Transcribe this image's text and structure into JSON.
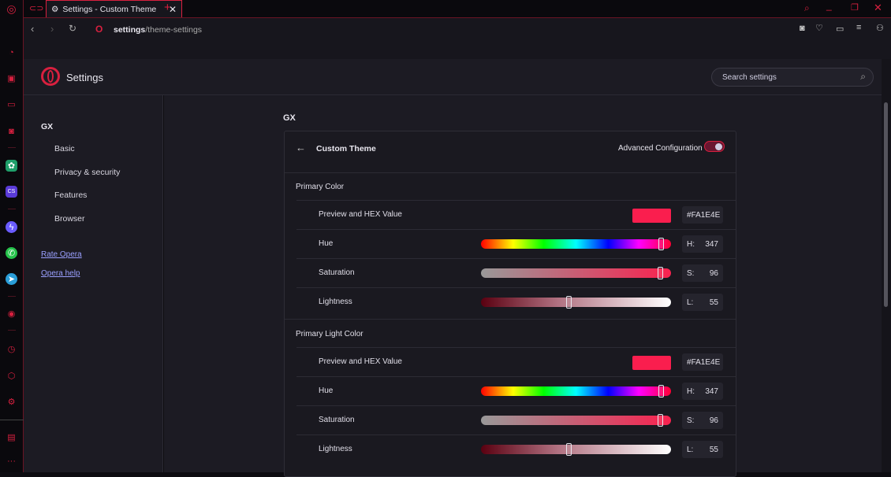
{
  "browser": {
    "tab_title": "Settings - Custom Theme",
    "url_bold": "settings",
    "url_rest": "/theme-settings"
  },
  "settings": {
    "title": "Settings",
    "search_placeholder": "Search settings"
  },
  "nav": {
    "group": "GX",
    "items": [
      "Basic",
      "Privacy & security",
      "Features",
      "Browser"
    ],
    "links": [
      "Rate Opera",
      "Opera help"
    ]
  },
  "page": {
    "section": "GX",
    "card_title": "Custom Theme",
    "advanced_label": "Advanced Configuration",
    "advanced_on": true
  },
  "sections": [
    {
      "title": "Primary Color",
      "preview_label": "Preview and HEX Value",
      "hex": "FA1E4E",
      "swatch": "#fa1e4e",
      "hue_label": "Hue",
      "hue_prefix": "H:",
      "hue": "347",
      "sat_label": "Saturation",
      "sat_prefix": "S:",
      "sat": "96",
      "light_label": "Lightness",
      "light_prefix": "L:",
      "light": "55"
    },
    {
      "title": "Primary Light Color",
      "preview_label": "Preview and HEX Value",
      "hex": "FA1E4E",
      "swatch": "#fa1e4e",
      "hue_label": "Hue",
      "hue_prefix": "H:",
      "hue": "347",
      "sat_label": "Saturation",
      "sat_prefix": "S:",
      "sat": "96",
      "light_label": "Lightness",
      "light_prefix": "L:",
      "light": "55"
    }
  ],
  "hash": "#",
  "colors": {
    "accent": "#d8203f"
  }
}
